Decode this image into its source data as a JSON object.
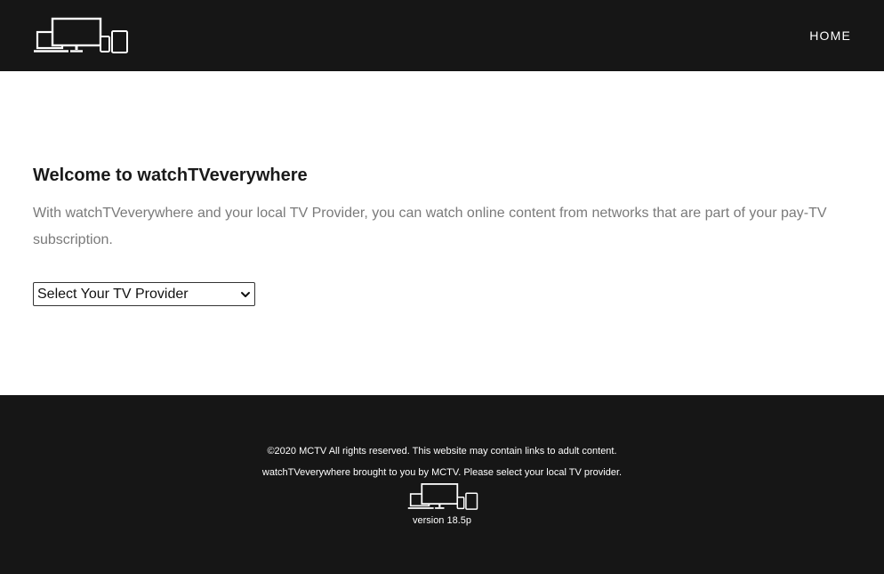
{
  "header": {
    "logo_icon": "devices-icon",
    "nav": {
      "home_label": "HOME"
    }
  },
  "main": {
    "title": "Welcome to watchTVeverywhere",
    "description": "With watchTVeverywhere and your local TV Provider, you can watch online content from networks that are part of your pay-TV subscription.",
    "provider_select": {
      "selected": "Select Your TV Provider",
      "icon": "chevron-down-icon"
    }
  },
  "footer": {
    "copyright": "©2020 MCTV All rights reserved. This website may contain links to adult content.",
    "brought_by": "watchTVeverywhere brought to you by MCTV. Please select your local TV provider.",
    "logo_icon": "devices-icon",
    "version": "version 18.5p"
  },
  "colors": {
    "header_bg": "#161616",
    "footer_bg": "#161616",
    "body_text": "#7a7a7a",
    "title_text": "#1a1a1a"
  }
}
